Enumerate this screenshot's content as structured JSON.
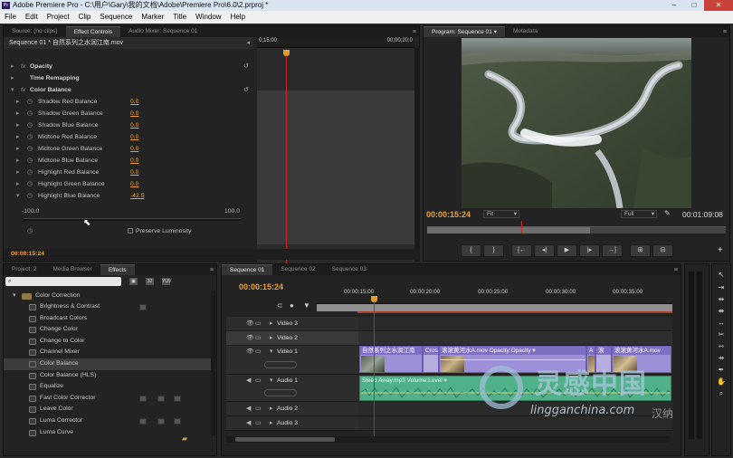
{
  "window": {
    "title": "Adobe Premiere Pro - C:\\用户\\Gary\\我的文档\\Adobe\\Premiere Pro\\6.0\\2.prproj *",
    "app_icon": "Pr"
  },
  "menu": [
    "File",
    "Edit",
    "Project",
    "Clip",
    "Sequence",
    "Marker",
    "Title",
    "Window",
    "Help"
  ],
  "source_panel": {
    "tabs": [
      "Source: (no clips)",
      "Effect Controls",
      "Audio Mixer: Sequence 01"
    ],
    "active_tab": "Effect Controls",
    "clip_header": "Sequence 01 * 自然系列之水润江南.mov",
    "ruler_start": "0;15;00",
    "ruler_end": "00;00;20;0",
    "effects": [
      {
        "label": "Opacity",
        "expanded": false
      },
      {
        "label": "Time Remapping",
        "expanded": false
      },
      {
        "label": "Color Balance",
        "expanded": true
      }
    ],
    "params": [
      {
        "label": "Shadow Red Balance",
        "value": "0.0"
      },
      {
        "label": "Shadow Green Balance",
        "value": "0.0"
      },
      {
        "label": "Shadow Blue Balance",
        "value": "0.0"
      },
      {
        "label": "Midtone Red Balance",
        "value": "0.0"
      },
      {
        "label": "Midtone Green Balance",
        "value": "0.0"
      },
      {
        "label": "Midtone Blue Balance",
        "value": "0.0"
      },
      {
        "label": "Highlight Red Balance",
        "value": "0.0"
      },
      {
        "label": "Highlight Green Balance",
        "value": "0.0"
      },
      {
        "label": "Highlight Blue Balance",
        "value": "-42.5"
      }
    ],
    "slider": {
      "min": "-100.0",
      "max": "100.0"
    },
    "preserve_luminosity": "Preserve Luminosity",
    "timecode": "00:00:15:24"
  },
  "program_panel": {
    "tabs": [
      "Program: Sequence 01",
      "Metadata"
    ],
    "timecode": "00:00:15:24",
    "fit": "Fit",
    "quality": "Full",
    "duration": "00:01:09:08",
    "transport_buttons": [
      "{",
      "}",
      "{←",
      "◂|",
      "▶",
      "|▸",
      "→}",
      "⊞",
      "⊟"
    ]
  },
  "project_panel": {
    "tabs": [
      "Project: 2",
      "Media Browser",
      "Effects"
    ],
    "active_tab": "Effects",
    "search_placeholder": "",
    "folder": "Color Correction",
    "items": [
      {
        "label": "Brightness & Contrast",
        "badges": 1
      },
      {
        "label": "Broadcast Colors",
        "badges": 0
      },
      {
        "label": "Change Color",
        "badges": 0
      },
      {
        "label": "Change to Color",
        "badges": 0
      },
      {
        "label": "Channel Mixer",
        "badges": 0
      },
      {
        "label": "Color Balance",
        "badges": 0,
        "selected": true
      },
      {
        "label": "Color Balance (HLS)",
        "badges": 0
      },
      {
        "label": "Equalize",
        "badges": 0
      },
      {
        "label": "Fast Color Corrector",
        "badges": 3
      },
      {
        "label": "Leave Color",
        "badges": 0
      },
      {
        "label": "Luma Corrector",
        "badges": 3
      },
      {
        "label": "Luma Curve",
        "badges": 0
      }
    ]
  },
  "timeline_panel": {
    "tabs": [
      "Sequence 01",
      "Sequence 02",
      "Sequence 03"
    ],
    "active_tab": "Sequence 01",
    "timecode": "00:00:15:24",
    "ruler": [
      "00:00:15:00",
      "00:00:20:00",
      "00:00:25:00",
      "00:00:30:00",
      "00:00:35:00"
    ],
    "tracks": [
      {
        "name": "Video 3",
        "kind": "video"
      },
      {
        "name": "Video 2",
        "kind": "video"
      },
      {
        "name": "Video 1",
        "kind": "video"
      },
      {
        "name": "Audio 1",
        "kind": "audio"
      },
      {
        "name": "Audio 2",
        "kind": "audio"
      },
      {
        "name": "Audio 3",
        "kind": "audio"
      }
    ],
    "video_clips": [
      {
        "label": "自然系列之水润江南"
      },
      {
        "label": "Cros"
      },
      {
        "label": "滚滚黄河水A.mov  Opacity:Opacity ▾"
      },
      {
        "label": "A"
      },
      {
        "label": "滚"
      },
      {
        "label": "滚滚黄河水A.mov"
      }
    ],
    "audio_clip": "Sleep Away.mp3  Volume:Level ▾"
  },
  "watermark": {
    "cn": "灵感中国",
    "url": "lingganchina.com",
    "tag": "汉纳"
  },
  "colors": {
    "accent": "#e8a13a",
    "playhead": "#c8262a",
    "video_clip": "#9d8fd8",
    "audio_clip": "#4fb08a"
  }
}
